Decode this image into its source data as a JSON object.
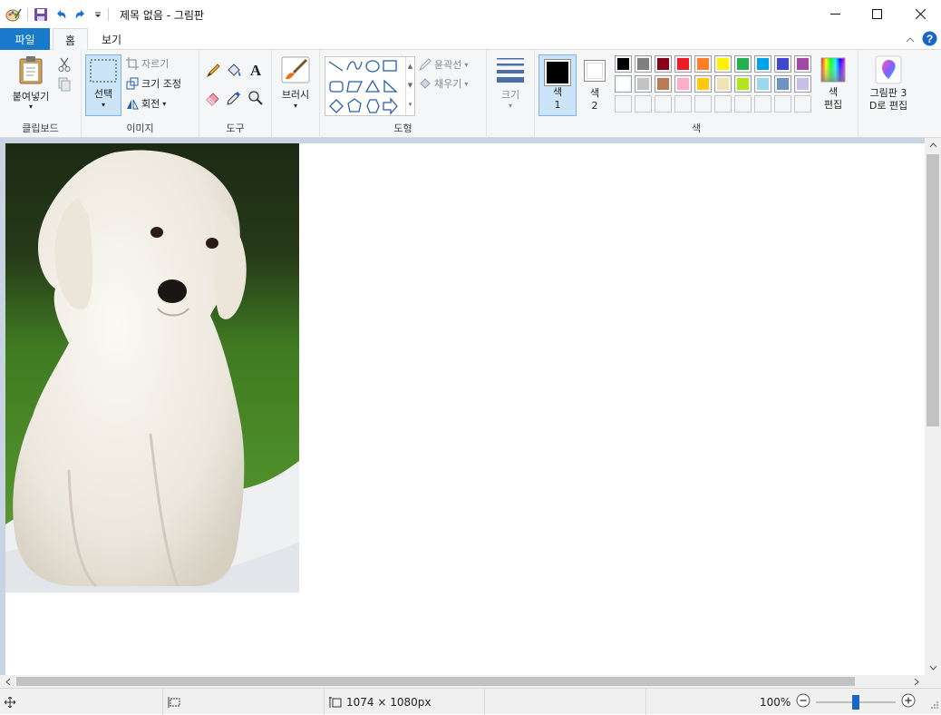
{
  "window": {
    "title": "제목 없음 - 그림판",
    "buttons": {
      "minimize": "—",
      "maximize": "☐",
      "close": "✕"
    }
  },
  "tabs": {
    "file": "파일",
    "home": "홈",
    "view": "보기"
  },
  "ribbon": {
    "clipboard": {
      "paste": "붙여넣기",
      "group_label": "클립보드"
    },
    "image": {
      "select": "선택",
      "crop": "자르기",
      "resize": "크기 조정",
      "rotate": "회전",
      "group_label": "이미지"
    },
    "tools": {
      "group_label": "도구"
    },
    "brushes": {
      "label": "브러시"
    },
    "shapes": {
      "outline": "윤곽선",
      "fill": "채우기",
      "group_label": "도형"
    },
    "size": {
      "label": "크기"
    },
    "colors": {
      "color1_line1": "색",
      "color1_line2": "1",
      "color2_line1": "색",
      "color2_line2": "2",
      "edit_line1": "색",
      "edit_line2": "편집",
      "group_label": "색",
      "color1_value": "#000000",
      "color2_value": "#ffffff",
      "palette_row1": [
        "#000000",
        "#7f7f7f",
        "#880015",
        "#ed1c24",
        "#ff7f27",
        "#fff200",
        "#22b14c",
        "#00a2e8",
        "#3f48cc",
        "#a349a4"
      ],
      "palette_row2": [
        "#ffffff",
        "#c3c3c3",
        "#b97a57",
        "#ffaec9",
        "#ffc90e",
        "#efe4b0",
        "#b5e61d",
        "#99d9ea",
        "#7092be",
        "#c8bfe7"
      ],
      "palette_row3": [
        "",
        "",
        "",
        "",
        "",
        "",
        "",
        "",
        "",
        ""
      ]
    },
    "paint3d": {
      "line1": "그림판 3",
      "line2": "D로 편집"
    }
  },
  "status": {
    "image_size": "1074 × 1080px",
    "zoom": "100%",
    "zoom_level": 0.5
  }
}
